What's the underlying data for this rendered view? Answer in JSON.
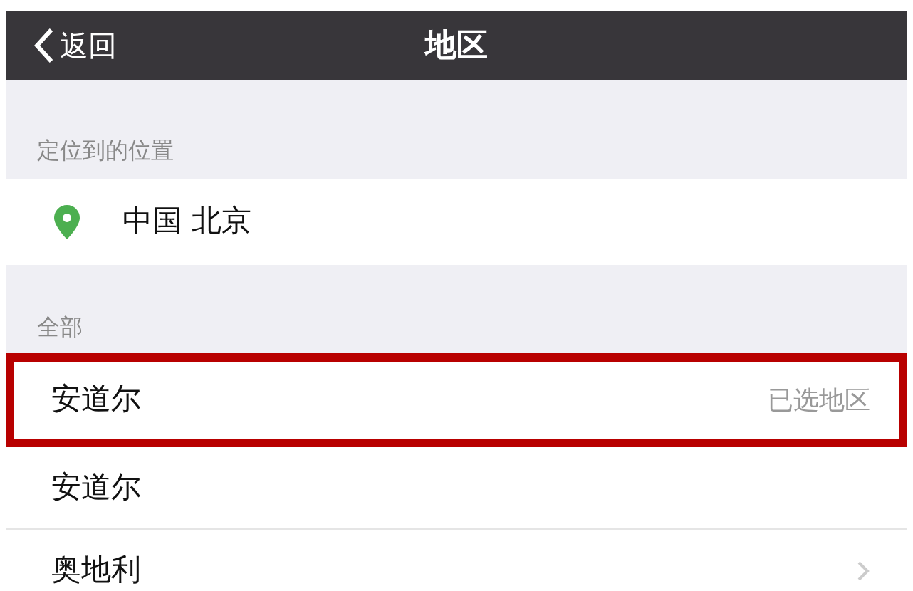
{
  "nav_bar": {
    "back_label": "返回",
    "title": "地区"
  },
  "located_section": {
    "header": "定位到的位置",
    "location": "中国 北京"
  },
  "all_section": {
    "header": "全部",
    "rows": [
      {
        "name": "安道尔",
        "detail": "已选地区",
        "selected": true,
        "chevron": false
      },
      {
        "name": "安道尔",
        "selected": false,
        "chevron": false
      },
      {
        "name": "奥地利",
        "selected": false,
        "chevron": true
      }
    ]
  }
}
